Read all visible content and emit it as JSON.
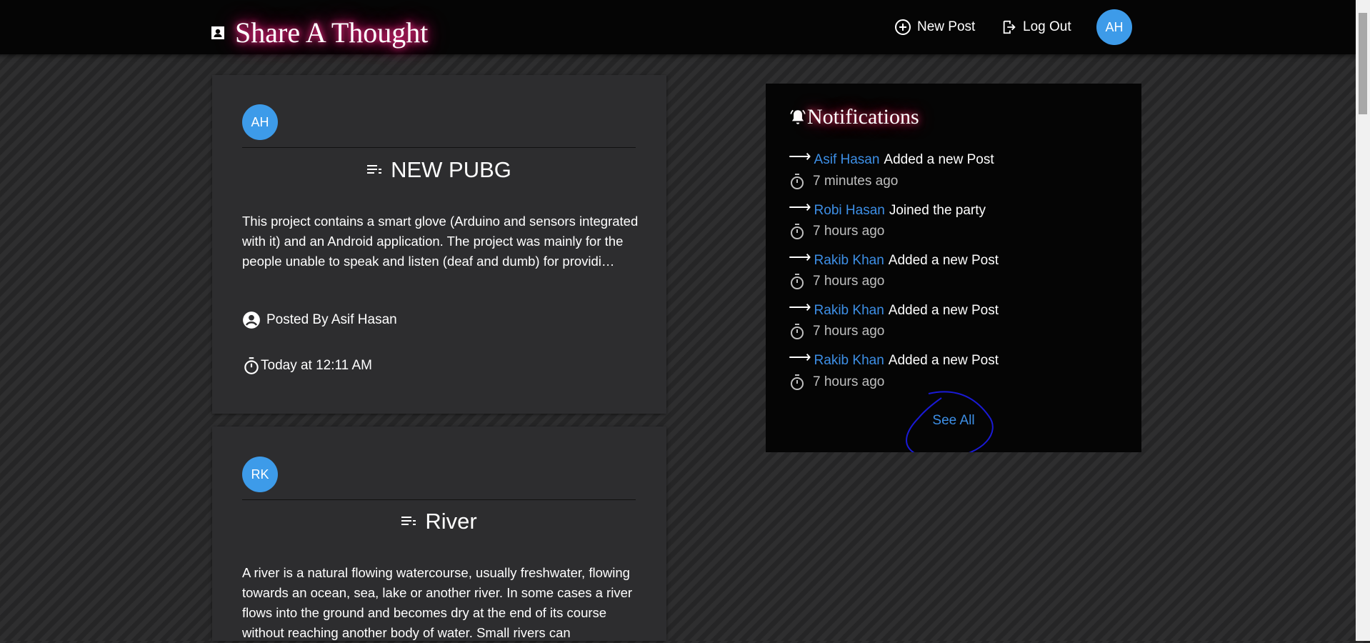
{
  "nav": {
    "brand": "Share A Thought",
    "new_post": "New Post",
    "log_out": "Log Out",
    "user_initials": "AH"
  },
  "posts": [
    {
      "initials": "AH",
      "title": "NEW PUBG",
      "excerpt": "This project contains a smart glove (Arduino and sensors integrated with it) and an Android application. The project was mainly for the people unable to speak and listen (deaf and dumb) for providi…",
      "posted_by": "Posted By Asif Hasan",
      "time": "Today at 12:11 AM"
    },
    {
      "initials": "RK",
      "title": "River",
      "excerpt": "A river is a natural flowing watercourse, usually freshwater, flowing towards an ocean, sea, lake or another river. In some cases a river flows into the ground and becomes dry at the end of its course without reaching another body of water. Small rivers can"
    }
  ],
  "notifications": {
    "title": "Notifications",
    "items": [
      {
        "name": "Asif Hasan",
        "action": "Added a new Post",
        "time": "7 minutes ago"
      },
      {
        "name": "Robi Hasan",
        "action": "Joined the party",
        "time": "7 hours ago"
      },
      {
        "name": "Rakib Khan",
        "action": "Added a new Post",
        "time": "7 hours ago"
      },
      {
        "name": "Rakib Khan",
        "action": "Added a new Post",
        "time": "7 hours ago"
      },
      {
        "name": "Rakib Khan",
        "action": "Added a new Post",
        "time": "7 hours ago"
      }
    ],
    "see_all": "See All"
  },
  "icons": {
    "brand": "contact-card-icon",
    "new_post": "add-circle-icon",
    "log_out": "logout-icon",
    "post_title": "list-lines-icon",
    "posted_by": "account-circle-icon",
    "time": "stopwatch-icon",
    "notifications": "bell-ringing-icon",
    "notif_arrow": "right-arrow-icon"
  },
  "colors": {
    "accent": "#3d9be9",
    "link": "#3d8fe6",
    "glow": "#ff2b8a",
    "annotation": "#1a1ad6"
  }
}
